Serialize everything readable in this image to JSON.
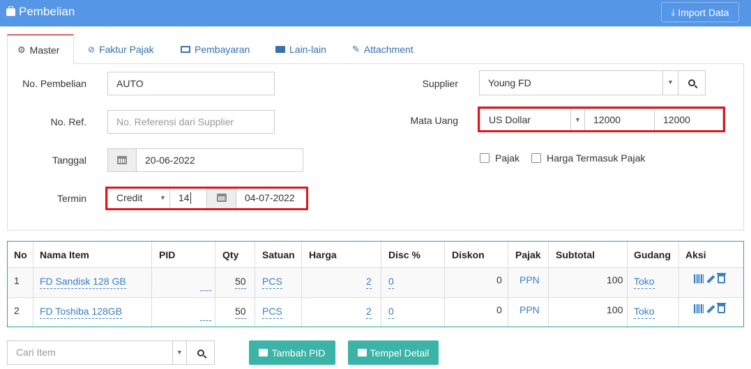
{
  "header": {
    "title": "Pembelian",
    "import_label": "Import Data"
  },
  "tabs": [
    {
      "label": "Master",
      "icon": "gears-icon"
    },
    {
      "label": "Faktur Pajak",
      "icon": "check-circle-icon"
    },
    {
      "label": "Pembayaran",
      "icon": "money-icon"
    },
    {
      "label": "Lain-lain",
      "icon": "truck-icon"
    },
    {
      "label": "Attachment",
      "icon": "paperclip-icon"
    }
  ],
  "form": {
    "no_pembelian": {
      "label": "No. Pembelian",
      "value": "AUTO"
    },
    "no_ref": {
      "label": "No. Ref.",
      "placeholder": "No. Referensi dari Supplier"
    },
    "tanggal": {
      "label": "Tanggal",
      "value": "20-06-2022"
    },
    "termin": {
      "label": "Termin",
      "type": "Credit",
      "days": "14",
      "due_date": "04-07-2022"
    },
    "supplier": {
      "label": "Supplier",
      "value": "Young FD"
    },
    "mata_uang": {
      "label": "Mata Uang",
      "currency": "US Dollar",
      "rate1": "12000",
      "rate2": "12000"
    },
    "pajak_label": "Pajak",
    "harga_termasuk_pajak_label": "Harga Termasuk Pajak"
  },
  "table": {
    "headers": [
      "No",
      "Nama Item",
      "PID",
      "Qty",
      "Satuan",
      "Harga",
      "Disc %",
      "Diskon",
      "Pajak",
      "Subtotal",
      "Gudang",
      "Aksi"
    ],
    "rows": [
      {
        "no": "1",
        "nama": "FD Sandisk 128 GB",
        "pid": "__",
        "qty": "50",
        "satuan": "PCS",
        "harga": "2",
        "disc": "0",
        "diskon": "0",
        "pajak": "PPN",
        "subtotal": "100",
        "gudang": "Toko"
      },
      {
        "no": "2",
        "nama": "FD Toshiba 128GB",
        "pid": "__",
        "qty": "50",
        "satuan": "PCS",
        "harga": "2",
        "disc": "0",
        "diskon": "0",
        "pajak": "PPN",
        "subtotal": "100",
        "gudang": "Toko"
      }
    ]
  },
  "bottom": {
    "search_placeholder": "Cari Item",
    "tambah_pid": "Tambah PID",
    "tempel_detail": "Tempel Detail"
  },
  "colors": {
    "header": "#5596e6",
    "accent_red": "#d9191f",
    "teal": "#3bb3a6",
    "link": "#3a7fc4"
  }
}
